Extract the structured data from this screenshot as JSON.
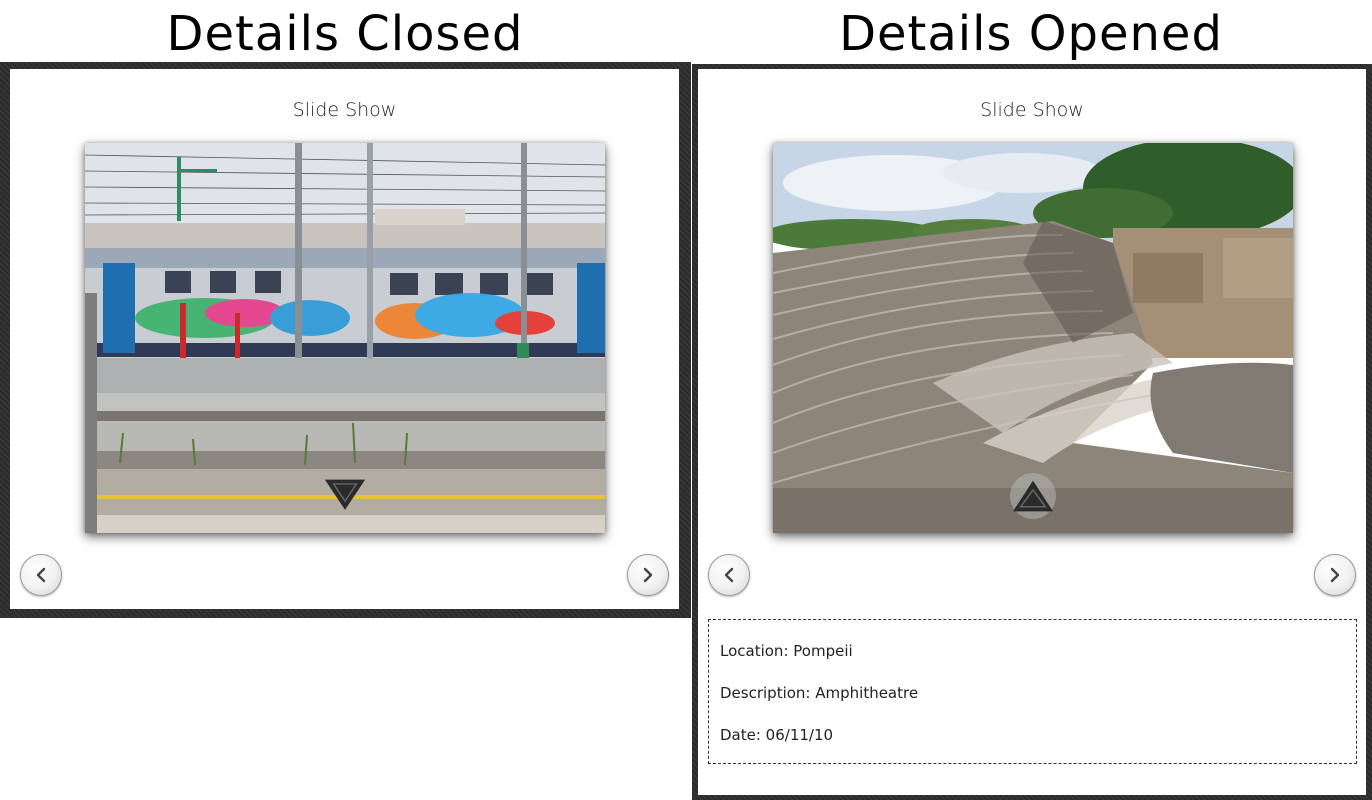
{
  "headings": {
    "left": "Details Closed",
    "right": "Details Opened"
  },
  "left_panel": {
    "title": "Slide Show",
    "photo_subject": "graffiti-covered train at railway platform",
    "toggle_icon": "chevron-down-icon",
    "prev_icon": "chevron-left-icon",
    "next_icon": "chevron-right-icon"
  },
  "right_panel": {
    "title": "Slide Show",
    "photo_subject": "amphitheatre ruins",
    "toggle_icon": "chevron-up-icon",
    "prev_icon": "chevron-left-icon",
    "next_icon": "chevron-right-icon",
    "details": {
      "location": "Location: Pompeii",
      "description": "Description: Amphitheatre",
      "date": "Date: 06/11/10"
    }
  },
  "colors": {
    "frame": "#2f2f2f",
    "panel": "#ffffff",
    "details_border": "#333333"
  }
}
